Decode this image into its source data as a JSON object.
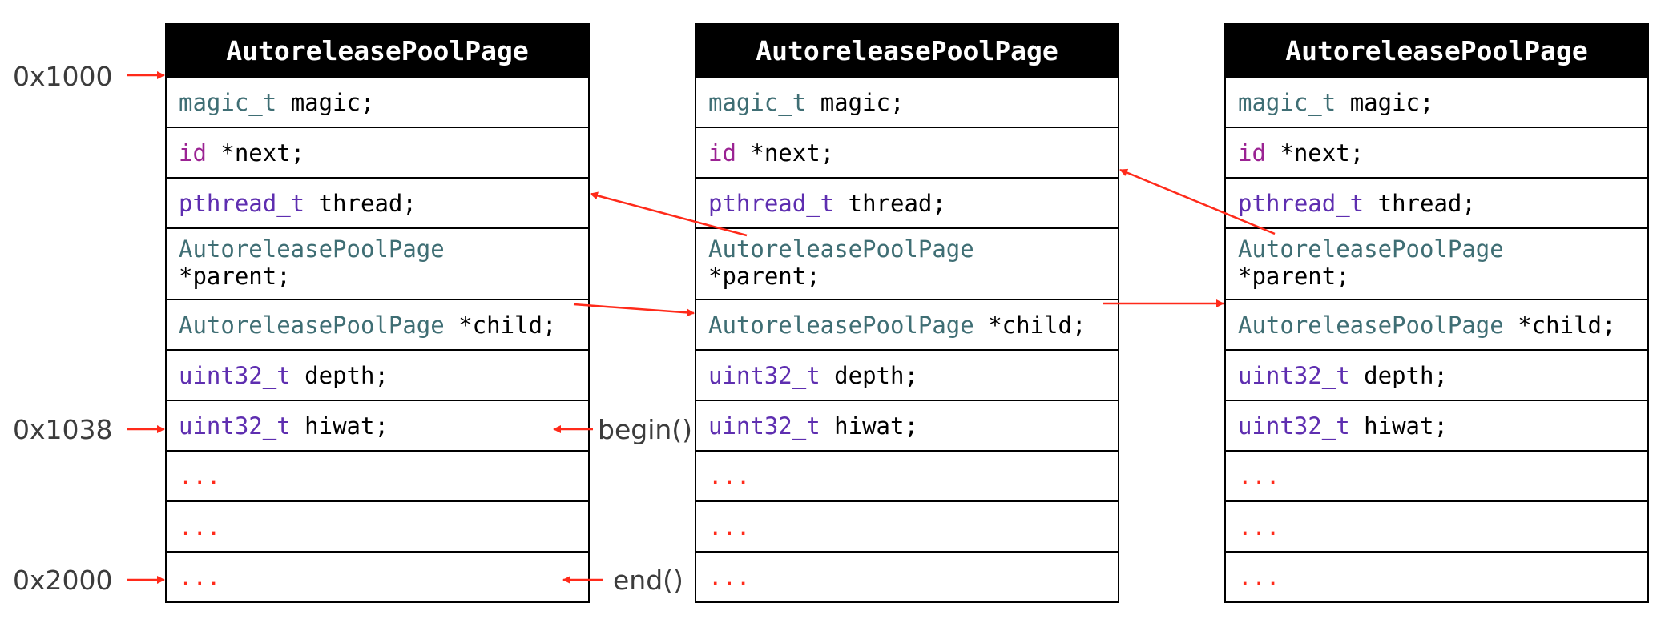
{
  "pages": [
    {
      "title": "AutoreleasePoolPage",
      "fields": [
        {
          "type": "magic_t",
          "rest": "magic;"
        },
        {
          "type": "id",
          "rest": "*next;"
        },
        {
          "type": "pthread_t",
          "rest": "thread;"
        },
        {
          "type": "AutoreleasePoolPage",
          "rest": "*parent;"
        },
        {
          "type": "AutoreleasePoolPage",
          "rest": "*child;"
        },
        {
          "type": "uint32_t",
          "rest": "depth;"
        },
        {
          "type": "uint32_t",
          "rest": "hiwat;"
        },
        {
          "ellipsis": "..."
        },
        {
          "ellipsis": "..."
        },
        {
          "ellipsis": "..."
        }
      ]
    },
    {
      "title": "AutoreleasePoolPage",
      "fields": [
        {
          "type": "magic_t",
          "rest": "magic;"
        },
        {
          "type": "id",
          "rest": "*next;"
        },
        {
          "type": "pthread_t",
          "rest": "thread;"
        },
        {
          "type": "AutoreleasePoolPage",
          "rest": "*parent;"
        },
        {
          "type": "AutoreleasePoolPage",
          "rest": "*child;"
        },
        {
          "type": "uint32_t",
          "rest": "depth;"
        },
        {
          "type": "uint32_t",
          "rest": "hiwat;"
        },
        {
          "ellipsis": "..."
        },
        {
          "ellipsis": "..."
        },
        {
          "ellipsis": "..."
        }
      ]
    },
    {
      "title": "AutoreleasePoolPage",
      "fields": [
        {
          "type": "magic_t",
          "rest": "magic;"
        },
        {
          "type": "id",
          "rest": "*next;"
        },
        {
          "type": "pthread_t",
          "rest": "thread;"
        },
        {
          "type": "AutoreleasePoolPage",
          "rest": "*parent;"
        },
        {
          "type": "AutoreleasePoolPage",
          "rest": "*child;"
        },
        {
          "type": "uint32_t",
          "rest": "depth;"
        },
        {
          "type": "uint32_t",
          "rest": "hiwat;"
        },
        {
          "ellipsis": "..."
        },
        {
          "ellipsis": "..."
        },
        {
          "ellipsis": "..."
        }
      ]
    }
  ],
  "addresses": {
    "start": "0x1000",
    "begin": "0x1038",
    "end": "0x2000"
  },
  "markers": {
    "begin": "begin()",
    "end": "end()"
  },
  "colors": {
    "arrow": "#ff2a1a",
    "type_teal": "#3f6e74",
    "type_magenta": "#9b2393",
    "type_purple": "#5e2eb0",
    "ellipsis": "#ff2a1a"
  }
}
